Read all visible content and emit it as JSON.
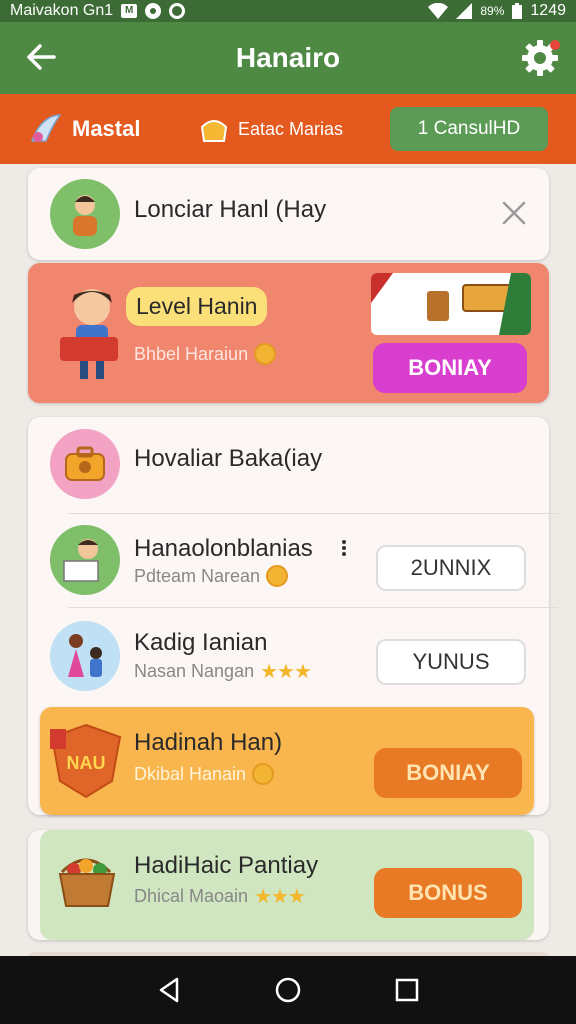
{
  "status": {
    "carrier": "Maivakon Gn1",
    "badge": "M",
    "battery": "89%",
    "time": "1249"
  },
  "header": {
    "title": "Hanairo"
  },
  "tabs": [
    {
      "label": "Mastal"
    },
    {
      "label": "Eatac Marias"
    },
    {
      "label": "1 CansulHD"
    }
  ],
  "items": [
    {
      "name": "Lonciar Hanl (Hay"
    },
    {
      "name": "Level Hanin",
      "sub": "Bhbel Haraiun",
      "button": "BONIAY"
    },
    {
      "name": "Hovaliar Baka(iay"
    },
    {
      "name": "Hanaolonblanias",
      "sub": "Pdteam Narean",
      "button": "2UNNIX"
    },
    {
      "name": "Kadig Ianian",
      "sub": "Nasan Nangan",
      "button": "YUNUS"
    },
    {
      "name": "Hadinah Han)",
      "sub": "Dkibal Hanain",
      "badge": "NAU",
      "button": "BONIAY"
    },
    {
      "name": "HadiHaic Pantiay",
      "sub": "Dhical Maoain",
      "button": "BONUS"
    }
  ],
  "colors": {
    "primary": "#4f8a44",
    "accent": "#e4591d",
    "magenta": "#d93fcf",
    "orange": "#e87a26"
  }
}
